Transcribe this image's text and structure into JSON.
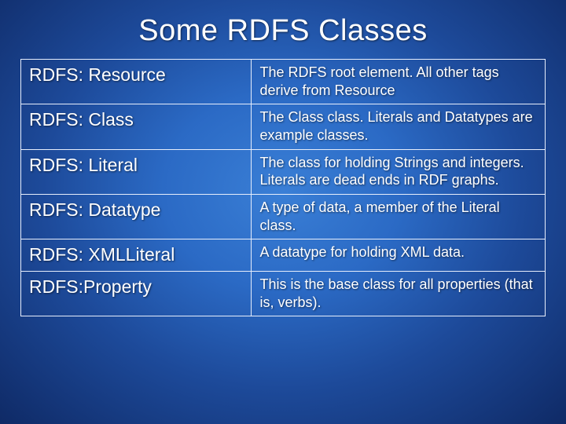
{
  "title": "Some RDFS Classes",
  "rows": [
    {
      "name": "RDFS: Resource",
      "desc": "The RDFS root element.  All other tags derive from Resource"
    },
    {
      "name": "RDFS: Class",
      "desc": "The Class class.  Literals and Datatypes are example classes."
    },
    {
      "name": "RDFS: Literal",
      "desc": "The class for holding Strings and integers.  Literals are dead ends in RDF graphs."
    },
    {
      "name": "RDFS: Datatype",
      "desc": "A type of data, a member of the  Literal class."
    },
    {
      "name": "RDFS: XMLLiteral",
      "desc": "A datatype for holding XML data."
    },
    {
      "name": "RDFS:Property",
      "desc": "This is the base class for all properties (that is, verbs)."
    }
  ]
}
